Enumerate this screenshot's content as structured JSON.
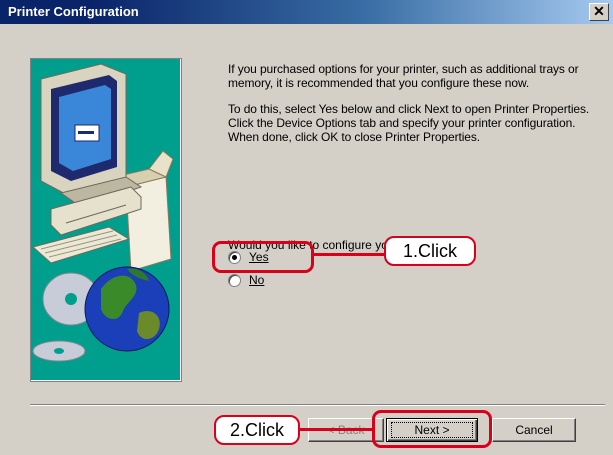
{
  "window": {
    "title": "Printer Configuration",
    "close_glyph": "✕"
  },
  "content": {
    "paragraph1": "If you purchased options for your printer, such as additional trays or memory, it is recommended that you configure these now.",
    "paragraph2": "To do this, select Yes below and click Next to open Printer Properties. Click the Device Options tab and specify your printer configuration. When done, click OK to close Printer Properties.",
    "question": "Would you like to configure your printer now?"
  },
  "options": {
    "yes": {
      "label": "Yes",
      "selected": true
    },
    "no": {
      "label": "No",
      "selected": false
    }
  },
  "buttons": {
    "back_label": "< Back",
    "next_label": "Next >",
    "cancel_label": "Cancel"
  },
  "annotations": {
    "step1": "1.Click",
    "step2": "2.Click",
    "color": "#d9001b"
  },
  "illustration": {
    "icons": [
      "computer-icon",
      "cd-disc-icon",
      "globe-icon",
      "box-icon"
    ]
  }
}
